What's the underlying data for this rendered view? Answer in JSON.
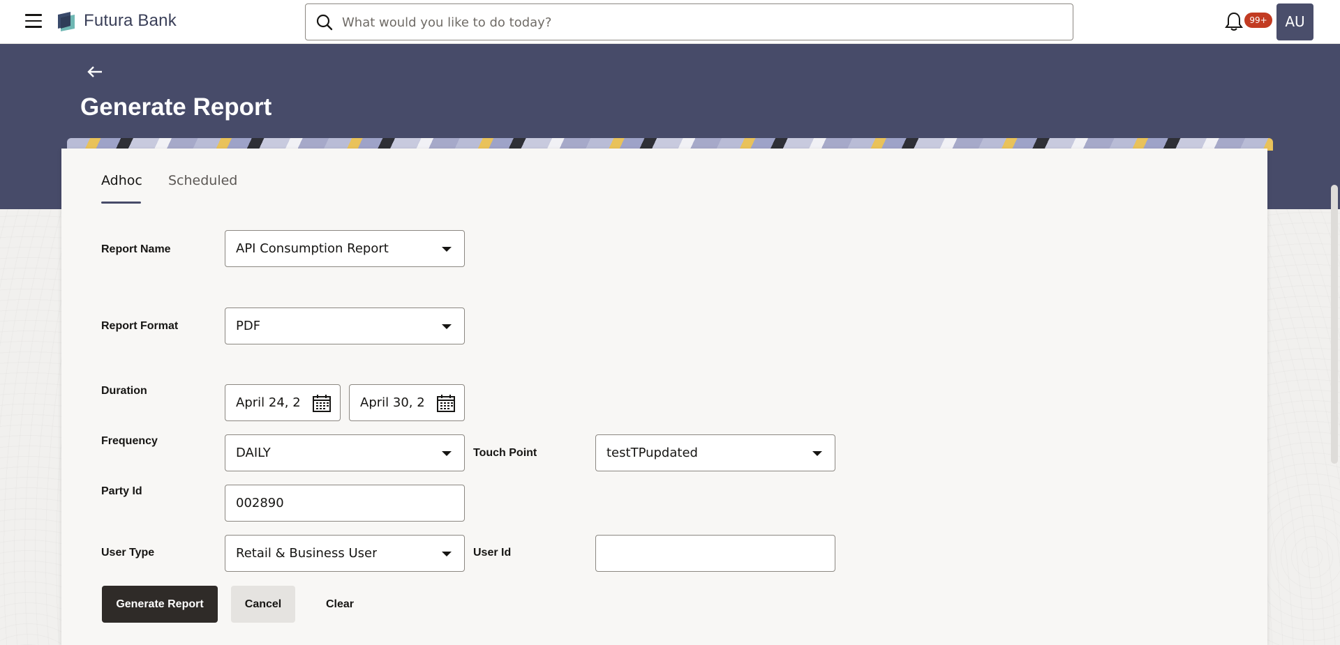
{
  "header": {
    "brand": "Futura Bank",
    "search_placeholder": "What would you like to do today?",
    "notification_count": "99+",
    "avatar_initials": "AU"
  },
  "page": {
    "title": "Generate Report"
  },
  "tabs": [
    {
      "label": "Adhoc",
      "active": true
    },
    {
      "label": "Scheduled",
      "active": false
    }
  ],
  "form": {
    "report_name": {
      "label": "Report Name",
      "value": "API Consumption Report"
    },
    "report_format": {
      "label": "Report Format",
      "value": "PDF"
    },
    "duration": {
      "label": "Duration",
      "from": "April 24, 2",
      "to": "April 30, 2"
    },
    "frequency": {
      "label": "Frequency",
      "value": "DAILY"
    },
    "touch_point": {
      "label": "Touch Point",
      "value": "testTPupdated"
    },
    "party_id": {
      "label": "Party Id",
      "value": "002890"
    },
    "user_type": {
      "label": "User Type",
      "value": "Retail & Business User"
    },
    "user_id": {
      "label": "User Id",
      "value": ""
    }
  },
  "actions": {
    "generate": "Generate Report",
    "cancel": "Cancel",
    "clear": "Clear"
  },
  "colors": {
    "banner": "#474b69",
    "primary_button": "#2f2b28",
    "badge": "#c23b22"
  }
}
